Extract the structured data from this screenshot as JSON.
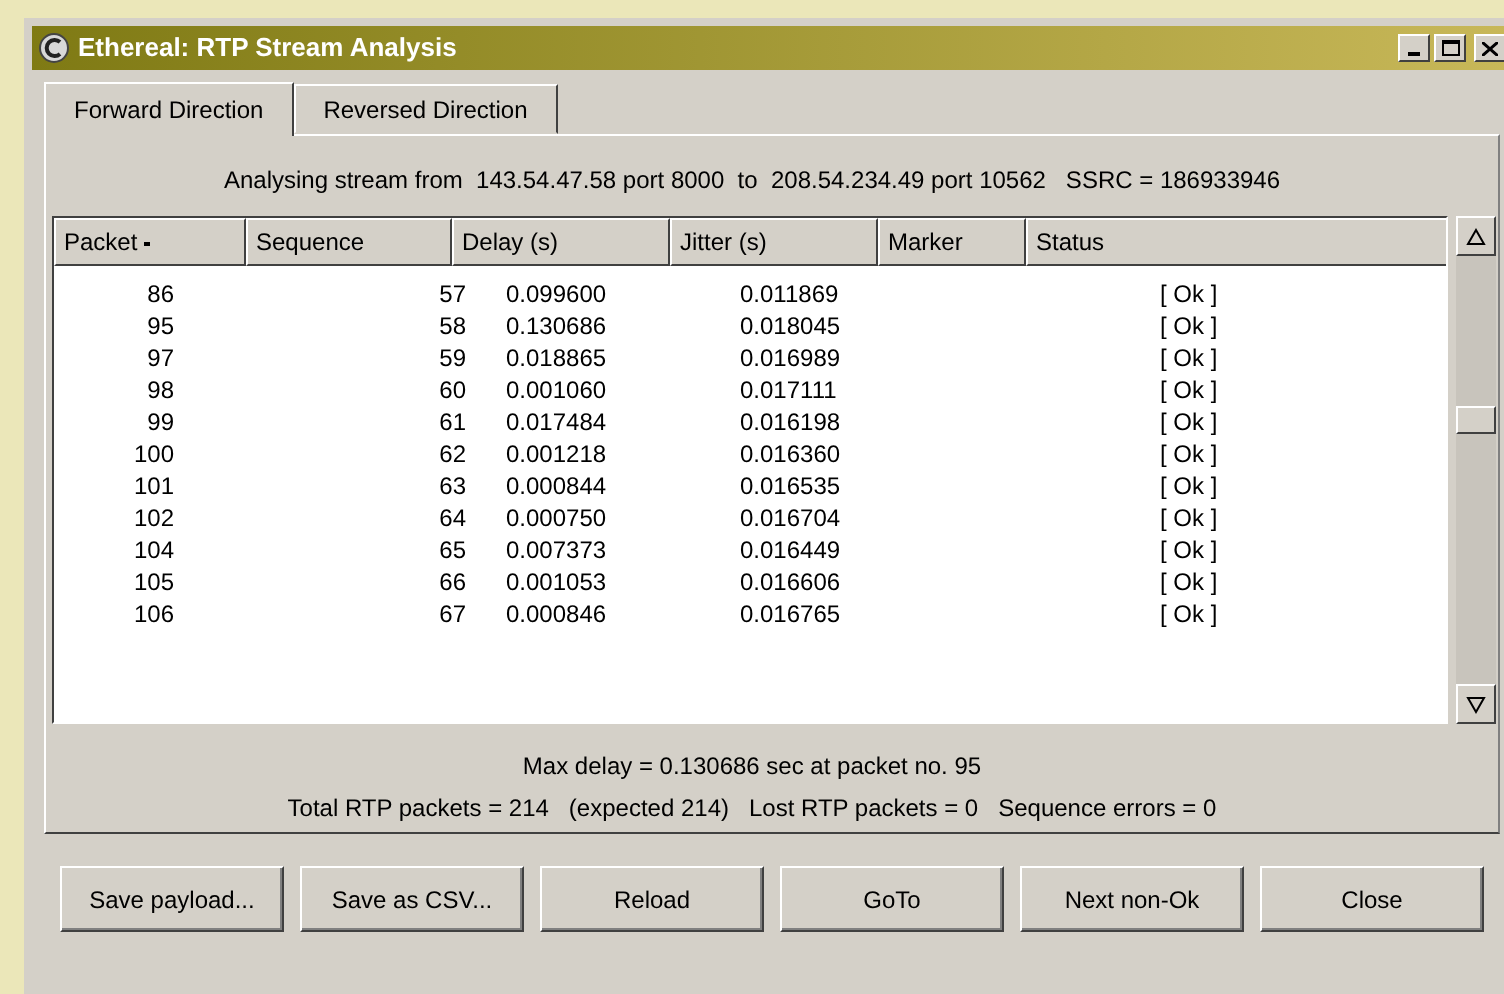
{
  "window": {
    "title": "Ethereal: RTP Stream Analysis"
  },
  "tabs": [
    {
      "label": "Forward Direction",
      "selected": true
    },
    {
      "label": "Reversed Direction",
      "selected": false
    }
  ],
  "stream_info": "Analysing stream from  143.54.47.58 port 8000  to  208.54.234.49 port 10562   SSRC = 186933946",
  "table": {
    "columns": [
      {
        "label": "Packet",
        "sorted": true
      },
      {
        "label": "Sequence",
        "sorted": false
      },
      {
        "label": "Delay (s)",
        "sorted": false
      },
      {
        "label": "Jitter (s)",
        "sorted": false
      },
      {
        "label": "Marker",
        "sorted": false
      },
      {
        "label": "Status",
        "sorted": false
      }
    ],
    "rows": [
      [
        "86",
        "57",
        "0.099600",
        "0.011869",
        "",
        "[ Ok ]"
      ],
      [
        "95",
        "58",
        "0.130686",
        "0.018045",
        "",
        "[ Ok ]"
      ],
      [
        "97",
        "59",
        "0.018865",
        "0.016989",
        "",
        "[ Ok ]"
      ],
      [
        "98",
        "60",
        "0.001060",
        "0.017111",
        "",
        "[ Ok ]"
      ],
      [
        "99",
        "61",
        "0.017484",
        "0.016198",
        "",
        "[ Ok ]"
      ],
      [
        "100",
        "62",
        "0.001218",
        "0.016360",
        "",
        "[ Ok ]"
      ],
      [
        "101",
        "63",
        "0.000844",
        "0.016535",
        "",
        "[ Ok ]"
      ],
      [
        "102",
        "64",
        "0.000750",
        "0.016704",
        "",
        "[ Ok ]"
      ],
      [
        "104",
        "65",
        "0.007373",
        "0.016449",
        "",
        "[ Ok ]"
      ],
      [
        "105",
        "66",
        "0.001053",
        "0.016606",
        "",
        "[ Ok ]"
      ],
      [
        "106",
        "67",
        "0.000846",
        "0.016765",
        "",
        "[ Ok ]"
      ]
    ]
  },
  "summary": [
    "Max delay = 0.130686 sec at packet no. 95",
    "Total RTP packets = 214   (expected 214)   Lost RTP packets = 0   Sequence errors = 0"
  ],
  "buttons": [
    "Save payload...",
    "Save as CSV...",
    "Reload",
    "GoTo",
    "Next non-Ok",
    "Close"
  ]
}
